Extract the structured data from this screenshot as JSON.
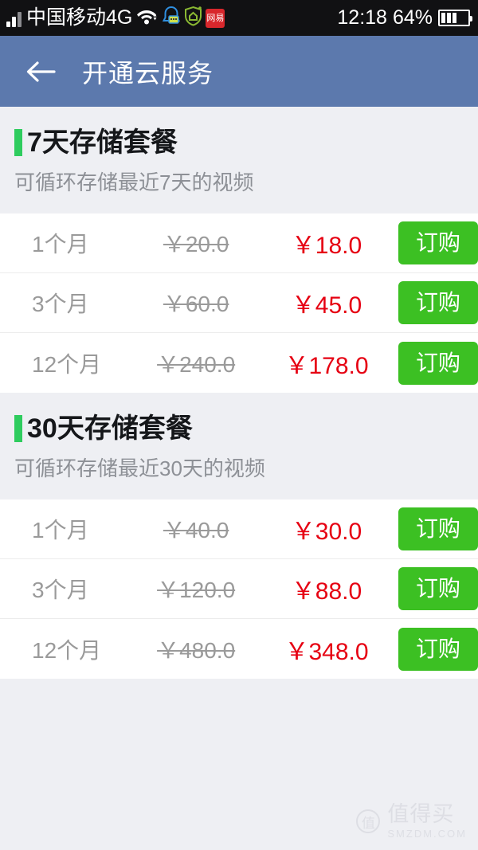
{
  "status_bar": {
    "carrier": "中国移动4G",
    "time": "12:18",
    "battery_percent": "64%",
    "icons": [
      "signal-bars-icon",
      "wifi-icon",
      "bell-icon",
      "shield-home-icon",
      "netease-app-icon",
      "battery-icon"
    ],
    "netease_label": "网易"
  },
  "app_bar": {
    "back_icon": "back-arrow-icon",
    "title": "开通云服务",
    "background_color": "#5c79ad"
  },
  "theme": {
    "accent_green": "#2ecc5e",
    "button_green": "#3cc023",
    "price_red": "#e60012",
    "page_background": "#eeeff3",
    "muted_text": "#9a9a9a"
  },
  "packages": [
    {
      "title": "7天存储套餐",
      "subtitle": "可循环存储最近7天的视频",
      "rows": [
        {
          "duration": "1个月",
          "old_price": "￥20.0",
          "new_price": "￥18.0",
          "button": "订购"
        },
        {
          "duration": "3个月",
          "old_price": "￥60.0",
          "new_price": "￥45.0",
          "button": "订购"
        },
        {
          "duration": "12个月",
          "old_price": "￥240.0",
          "new_price": "￥178.0",
          "button": "订购"
        }
      ]
    },
    {
      "title": "30天存储套餐",
      "subtitle": "可循环存储最近30天的视频",
      "rows": [
        {
          "duration": "1个月",
          "old_price": "￥40.0",
          "new_price": "￥30.0",
          "button": "订购"
        },
        {
          "duration": "3个月",
          "old_price": "￥120.0",
          "new_price": "￥88.0",
          "button": "订购"
        },
        {
          "duration": "12个月",
          "old_price": "￥480.0",
          "new_price": "￥348.0",
          "button": "订购"
        }
      ]
    }
  ],
  "watermark": {
    "badge": "值",
    "text": "值得买",
    "domain": "SMZDM.COM"
  }
}
